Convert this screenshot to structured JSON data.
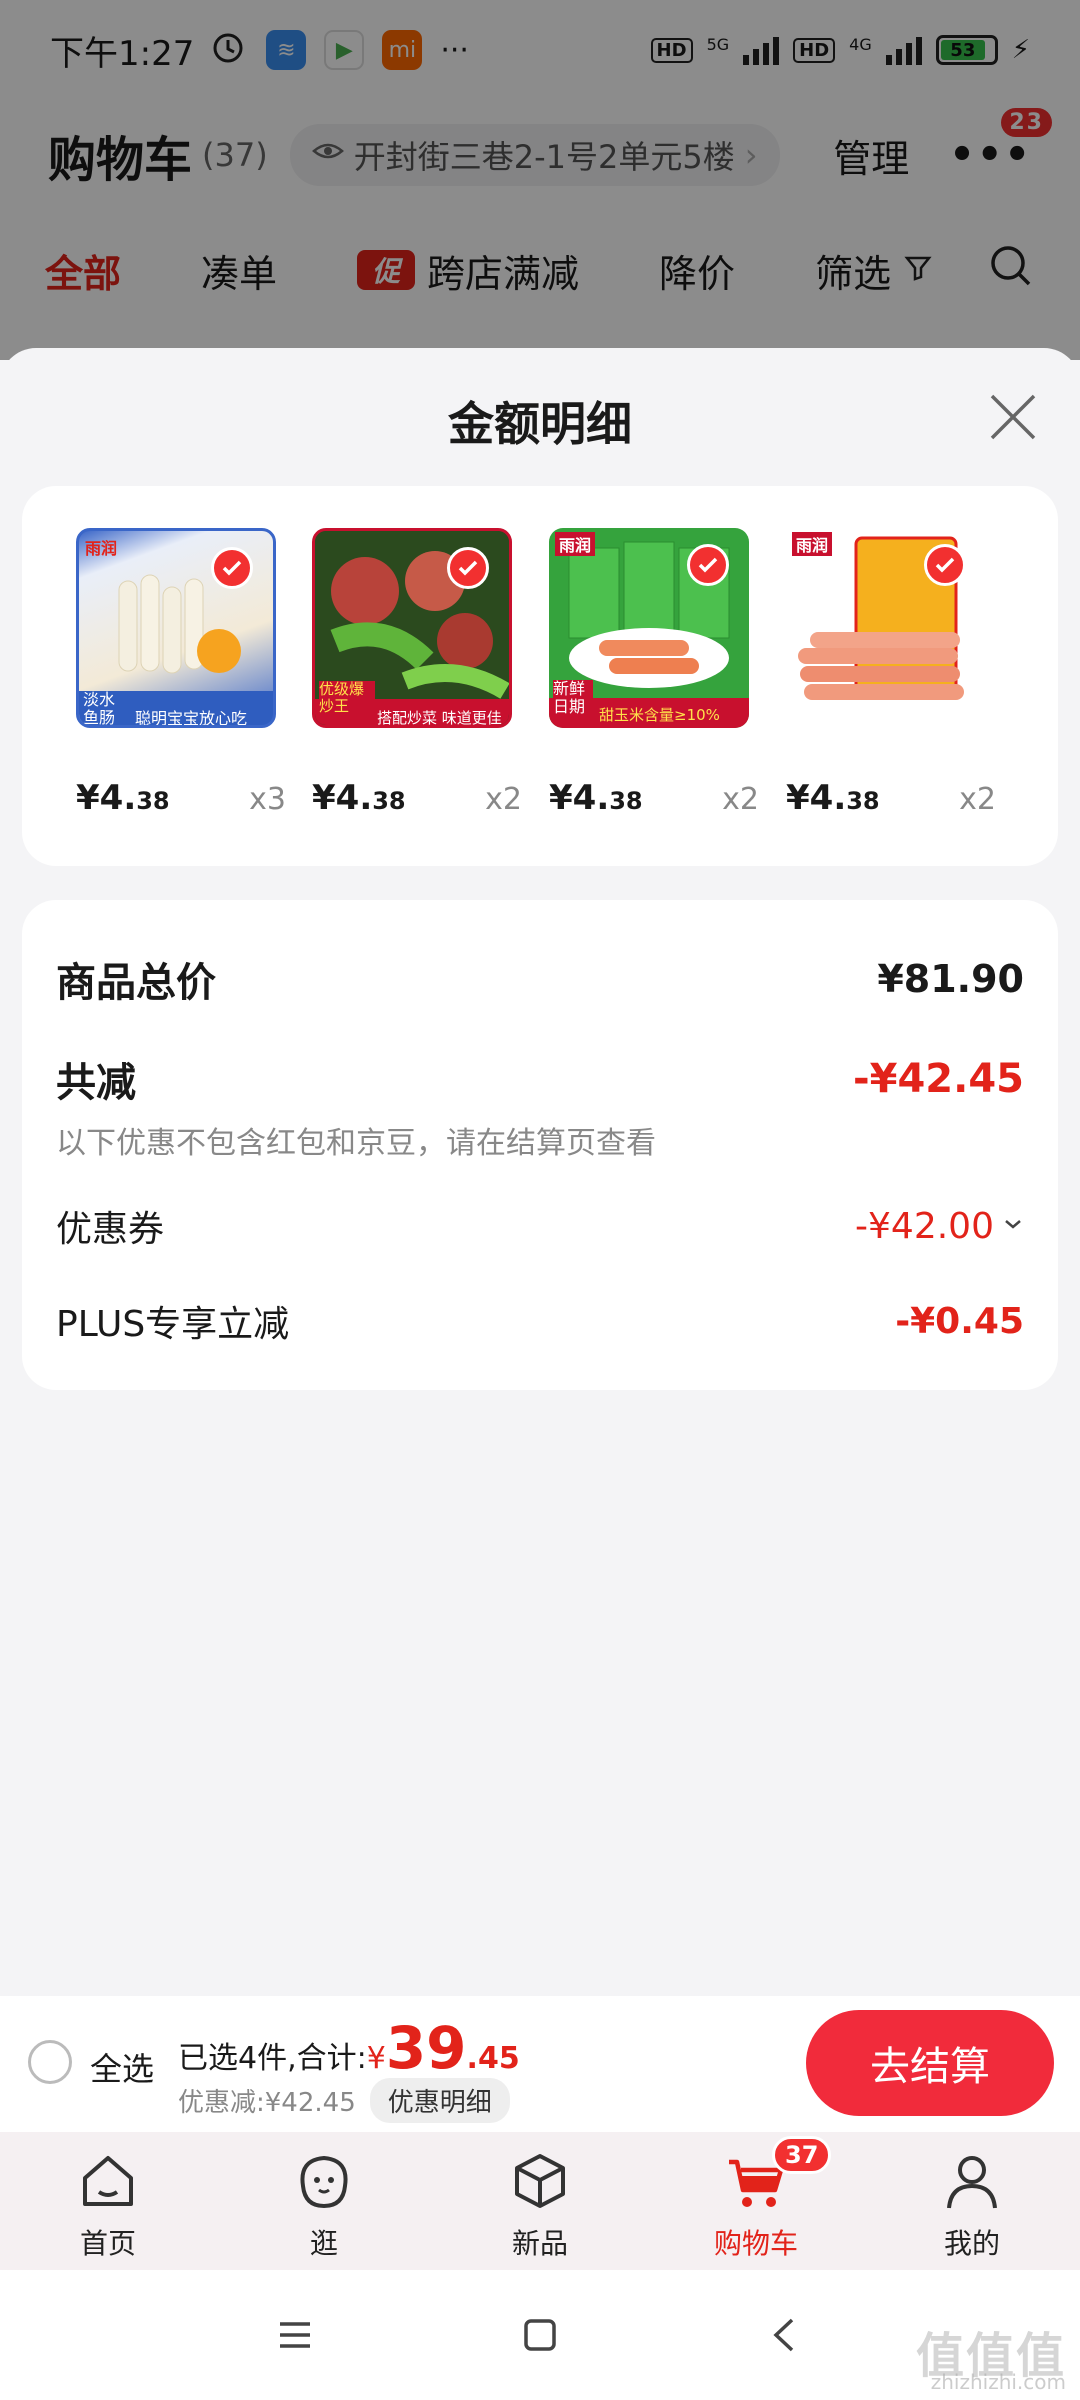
{
  "status_bar": {
    "time": "下午1:27",
    "network_5g": "5G",
    "network_4g": "4G",
    "hd": "HD",
    "battery": "53",
    "more": "···"
  },
  "header": {
    "title": "购物车",
    "count": "(37)",
    "address": "开封街三巷2-1号2单元5楼",
    "manage": "管理",
    "more_badge": "23"
  },
  "filter_tabs": {
    "all": "全部",
    "bundle": "凑单",
    "promo_tag": "促",
    "cross_store": "跨店满减",
    "price_drop": "降价",
    "filter": "筛选"
  },
  "sheet": {
    "title": "金额明细"
  },
  "products": [
    {
      "price_int": "¥4.",
      "price_dec": "38",
      "qty": "x3",
      "image_tag": "淡水鱼肠",
      "image_text": "聪明宝宝放心吃",
      "brand": "雨润"
    },
    {
      "price_int": "¥4.",
      "price_dec": "38",
      "qty": "x2",
      "image_tag": "优级爆炒王",
      "image_text": "搭配炒菜 味道更佳",
      "brand": "雨润"
    },
    {
      "price_int": "¥4.",
      "price_dec": "38",
      "qty": "x2",
      "image_tag": "新鲜日期",
      "image_text": "甜玉米含量≥10%",
      "brand": "雨润"
    },
    {
      "price_int": "¥4.",
      "price_dec": "38",
      "qty": "x2",
      "image_tag": "",
      "image_text": "",
      "brand": "雨润"
    }
  ],
  "summary": {
    "total_label": "商品总价",
    "total_value": "¥81.90",
    "discount_label": "共减",
    "discount_value": "-¥42.45",
    "note": "以下优惠不包含红包和京豆，请在结算页查看",
    "coupon_label": "优惠券",
    "coupon_value": "-¥42.00",
    "plus_label": "PLUS专享立减",
    "plus_value": "-¥0.45"
  },
  "checkout": {
    "select_all": "全选",
    "selected_text": "已选4件,合计:",
    "total_yen": "¥",
    "total_int": "39",
    "total_dec": ".45",
    "discount_text": "优惠减:¥42.45",
    "detail_pill": "优惠明细",
    "button": "去结算"
  },
  "nav": {
    "home": "首页",
    "browse": "逛",
    "new": "新品",
    "cart": "购物车",
    "cart_badge": "37",
    "mine": "我的"
  },
  "watermark": {
    "main": "值值值",
    "sub": "zhizhizhi.com"
  },
  "colors": {
    "accent_red": "#e2231a",
    "button_red": "#f12b3b",
    "sheet_bg": "#f4f4f6"
  }
}
